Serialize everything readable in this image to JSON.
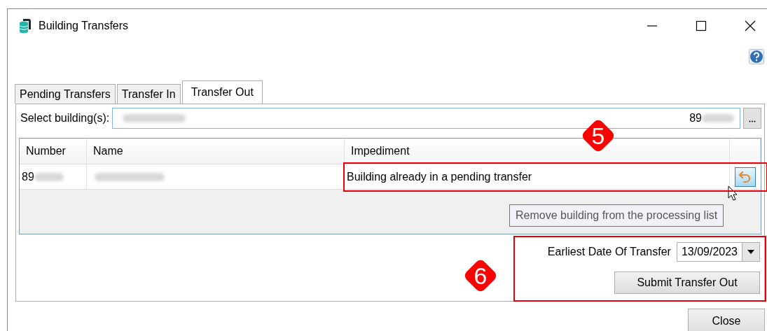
{
  "window": {
    "title": "Building Transfers"
  },
  "tabs": [
    {
      "label": "Pending Transfers",
      "selected": false
    },
    {
      "label": "Transfer In",
      "selected": false
    },
    {
      "label": "Transfer Out",
      "selected": true
    }
  ],
  "selector": {
    "label": "Select building(s):",
    "value_prefix": "89"
  },
  "table": {
    "columns": [
      "Number",
      "Name",
      "Impediment"
    ],
    "rows": [
      {
        "number_prefix": "89",
        "impediment": "Building already in a pending transfer"
      }
    ]
  },
  "tooltip": "Remove building from the processing list",
  "date": {
    "label": "Earliest Date Of Transfer",
    "value": "13/09/2023"
  },
  "submit_button": "Submit Transfer Out",
  "close_button": "Close",
  "annotations": [
    {
      "label": "5"
    },
    {
      "label": "6"
    }
  ]
}
